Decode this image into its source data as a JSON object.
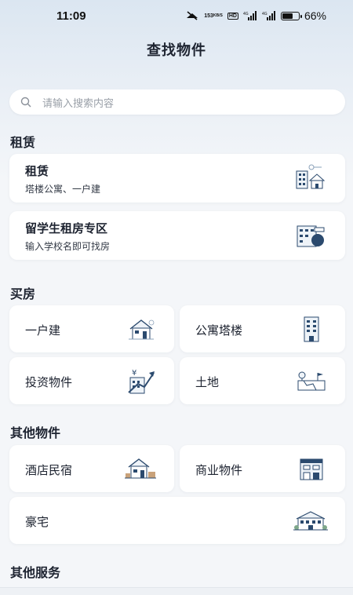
{
  "status_bar": {
    "time": "11:09",
    "speed_top": "153",
    "speed_unit": "KB/S",
    "hd": "HD",
    "network": "4G",
    "battery_level": 0.66,
    "battery_pct": "66%"
  },
  "header": {
    "title": "查找物件"
  },
  "search": {
    "placeholder": "请输入搜索内容"
  },
  "sections": {
    "rent": {
      "title": "租赁",
      "items": [
        {
          "title": "租赁",
          "subtitle": "塔楼公寓、一户建",
          "icon": "apartment-house-icon"
        },
        {
          "title": "留学生租房专区",
          "subtitle": "输入学校名即可找房",
          "icon": "student-building-icon"
        }
      ]
    },
    "buy": {
      "title": "买房",
      "items": [
        {
          "title": "一户建",
          "icon": "detached-house-icon"
        },
        {
          "title": "公寓塔楼",
          "icon": "tower-building-icon"
        },
        {
          "title": "投资物件",
          "icon": "investment-building-icon"
        },
        {
          "title": "土地",
          "icon": "land-icon"
        }
      ]
    },
    "other": {
      "title": "其他物件",
      "items": [
        {
          "title": "酒店民宿",
          "icon": "hotel-icon"
        },
        {
          "title": "商业物件",
          "icon": "commercial-building-icon"
        },
        {
          "title": "豪宅",
          "icon": "mansion-icon"
        }
      ]
    },
    "services": {
      "title": "其他服务"
    }
  },
  "colors": {
    "accent": "#2b4a6e",
    "background": "#f4f6f9",
    "card": "#ffffff"
  }
}
